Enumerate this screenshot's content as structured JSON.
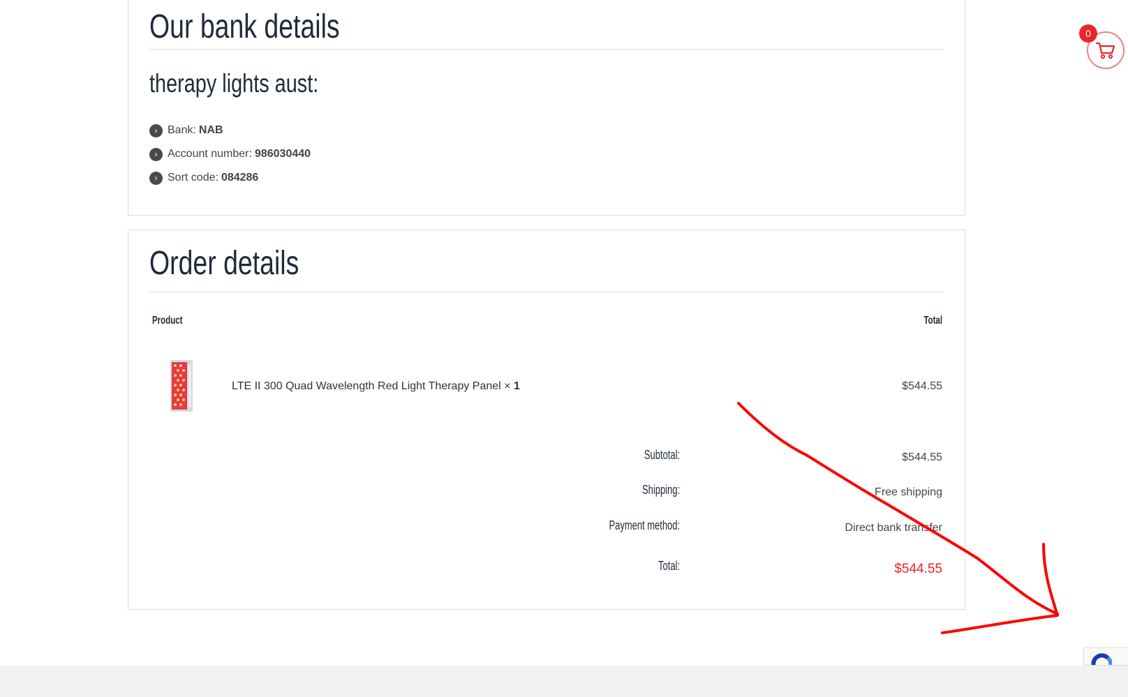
{
  "bank_section": {
    "title": "Our bank details",
    "account_name": "therapy lights aust:",
    "items": [
      {
        "label": "Bank:",
        "value": "NAB"
      },
      {
        "label": "Account number:",
        "value": "986030440"
      },
      {
        "label": "Sort code:",
        "value": "084286"
      }
    ]
  },
  "order_section": {
    "title": "Order details",
    "columns": {
      "product": "Product",
      "total": "Total"
    },
    "line_item": {
      "name": "LTE II 300 Quad Wavelength Red Light Therapy Panel",
      "qty_prefix": "×",
      "qty": "1",
      "price": "$544.55"
    },
    "summary": [
      {
        "label": "Subtotal:",
        "value": "$544.55"
      },
      {
        "label": "Shipping:",
        "value": "Free shipping"
      },
      {
        "label": "Payment method:",
        "value": "Direct bank transfer"
      }
    ],
    "total": {
      "label": "Total:",
      "value": "$544.55"
    }
  },
  "cart": {
    "count": "0"
  },
  "colors": {
    "accent": "#e8262b",
    "heading": "#1f2a3a",
    "annotation": "#ff0000"
  },
  "icons": {
    "bullet": "chevron-right-icon",
    "cart": "shopping-cart-icon",
    "recaptcha": "recaptcha-icon"
  }
}
